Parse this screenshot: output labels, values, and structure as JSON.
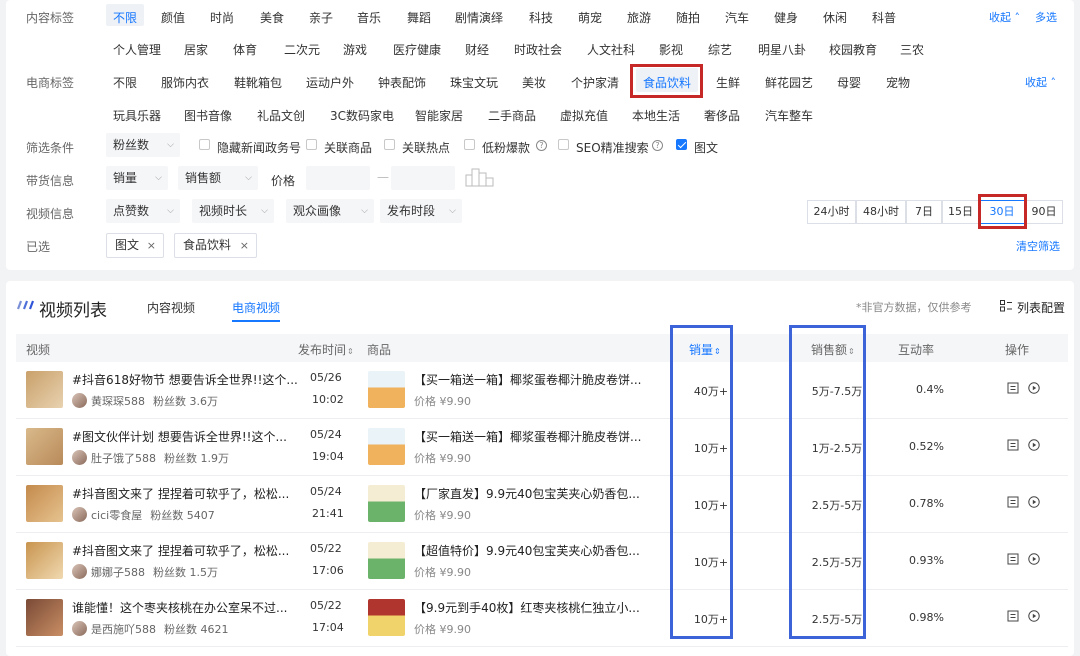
{
  "filters": {
    "content_tags": {
      "label": "内容标签",
      "row1": [
        "不限",
        "颜值",
        "时尚",
        "美食",
        "亲子",
        "音乐",
        "舞蹈",
        "剧情演绎",
        "科技",
        "萌宠",
        "旅游",
        "随拍",
        "汽车",
        "健身",
        "休闲",
        "科普"
      ],
      "row2": [
        "个人管理",
        "居家",
        "体育",
        "二次元",
        "游戏",
        "医疗健康",
        "财经",
        "时政社会",
        "人文社科",
        "影视",
        "综艺",
        "明星八卦",
        "校园教育",
        "三农"
      ],
      "collapse": "收起 ˄",
      "multi": "多选"
    },
    "ecom_tags": {
      "label": "电商标签",
      "row1": [
        "不限",
        "服饰内衣",
        "鞋靴箱包",
        "运动户外",
        "钟表配饰",
        "珠宝文玩",
        "美妆",
        "个护家清",
        "食品饮料",
        "生鲜",
        "鲜花园艺",
        "母婴",
        "宠物"
      ],
      "row2": [
        "玩具乐器",
        "图书音像",
        "礼品文创",
        "3C数码家电",
        "智能家居",
        "二手商品",
        "虚拟充值",
        "本地生活",
        "奢侈品",
        "汽车整车"
      ],
      "collapse": "收起 ˄"
    },
    "conditions": {
      "label": "筛选条件",
      "fans_dropdown": "粉丝数",
      "checkboxes": [
        "隐藏新闻政务号",
        "关联商品",
        "关联热点",
        "低粉爆款",
        "SEO精准搜索",
        "图文"
      ],
      "tooltip_mark": "?"
    },
    "sales_info": {
      "label": "带货信息",
      "sales_dropdown": "销量",
      "revenue_dropdown": "销售额",
      "price_label": "价格",
      "dash": "—"
    },
    "video_info": {
      "label": "视频信息",
      "dropdowns": [
        "点赞数",
        "视频时长",
        "观众画像",
        "发布时段"
      ],
      "time_ranges": [
        "24小时",
        "48小时",
        "7日",
        "15日",
        "30日",
        "90日"
      ]
    },
    "selected": {
      "label": "已选",
      "chips": [
        "图文",
        "食品饮料"
      ],
      "remove": "×",
      "clear": "清空筛选"
    }
  },
  "list": {
    "title": "视频列表",
    "tabs": [
      "内容视频",
      "电商视频"
    ],
    "note": "*非官方数据，仅供参考",
    "config": "列表配置",
    "columns": {
      "video": "视频",
      "publish_time": "发布时间",
      "product": "商品",
      "sales": "销量",
      "revenue": "销售额",
      "engagement": "互动率",
      "actions": "操作"
    },
    "sort_mark": "⇕",
    "rows": [
      {
        "title": "#抖音618好物节 想要告诉全世界!!这个...",
        "author": "黄琛琛588",
        "fans": "粉丝数 3.6万",
        "date": "05/26",
        "time": "10:02",
        "product": "【买一箱送一箱】椰浆蛋卷椰汁脆皮卷饼...",
        "price": "价格 ¥9.90",
        "sales": "40万+",
        "revenue": "5万-7.5万",
        "engagement": "0.4%"
      },
      {
        "title": "#图文伙伴计划 想要告诉全世界!!这个...",
        "author": "肚子饿了588",
        "fans": "粉丝数 1.9万",
        "date": "05/24",
        "time": "19:04",
        "product": "【买一箱送一箱】椰浆蛋卷椰汁脆皮卷饼...",
        "price": "价格 ¥9.90",
        "sales": "10万+",
        "revenue": "1万-2.5万",
        "engagement": "0.52%"
      },
      {
        "title": "#抖音图文来了 捏捏着可软乎了，松松...",
        "author": "cici零食屋",
        "fans": "粉丝数 5407",
        "date": "05/24",
        "time": "21:41",
        "product": "【厂家直发】9.9元40包宝芙夹心奶香包...",
        "price": "价格 ¥9.90",
        "sales": "10万+",
        "revenue": "2.5万-5万",
        "engagement": "0.78%"
      },
      {
        "title": "#抖音图文来了 捏捏着可软乎了，松松...",
        "author": "娜娜子588",
        "fans": "粉丝数 1.5万",
        "date": "05/22",
        "time": "17:06",
        "product": "【超值特价】9.9元40包宝芙夹心奶香包...",
        "price": "价格 ¥9.90",
        "sales": "10万+",
        "revenue": "2.5万-5万",
        "engagement": "0.93%"
      },
      {
        "title": "谁能懂！这个枣夹核桃在办公室呆不过...",
        "author": "是西施吖588",
        "fans": "粉丝数 4621",
        "date": "05/22",
        "time": "17:04",
        "product": "【9.9元到手40枚】红枣夹核桃仁独立小...",
        "price": "价格 ¥9.90",
        "sales": "10万+",
        "revenue": "2.5万-5万",
        "engagement": "0.98%"
      }
    ]
  },
  "colors": {
    "accent": "#1677ff",
    "highlight_red": "#c62828",
    "highlight_blue": "#3c63d8"
  }
}
